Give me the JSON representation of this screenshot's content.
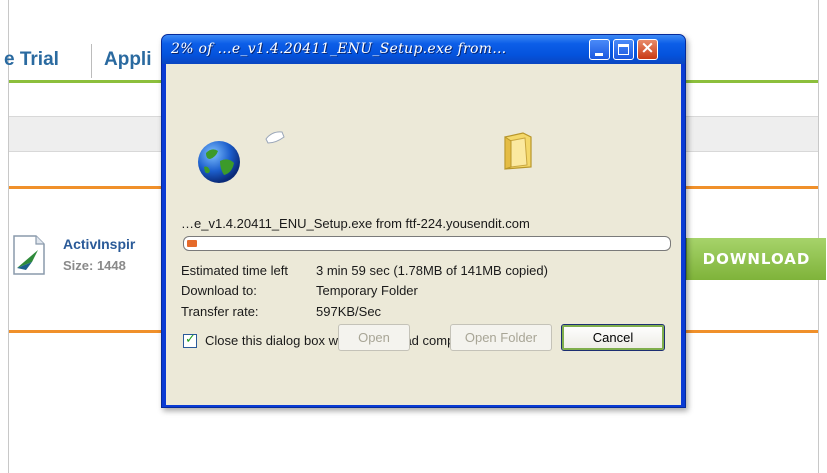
{
  "page": {
    "tabs": [
      {
        "label": "e Trial"
      },
      {
        "label": "Appli"
      }
    ],
    "file": {
      "name": "ActivInspir",
      "size": "Size: 1448"
    },
    "download_button": "DOWNLOAD"
  },
  "dialog": {
    "title": "2% of …e_v1.4.20411_ENU_Setup.exe from…",
    "filename_line": "…e_v1.4.20411_ENU_Setup.exe from ftf-224.yousendit.com",
    "progress_percent": 2,
    "progress_color": "#e56a2a",
    "estimated_label": "Estimated time left",
    "estimated_value": "3 min 59 sec (1.78MB of 141MB copied)",
    "download_to_label": "Download to:",
    "download_to_value": "Temporary Folder",
    "transfer_rate_label": "Transfer rate:",
    "transfer_rate_value": "597KB/Sec",
    "close_checkbox_label": "Close this dialog box when download completes",
    "close_checkbox_checked": true,
    "buttons": {
      "open": "Open",
      "open_folder": "Open Folder",
      "cancel": "Cancel"
    },
    "title_buttons": {
      "minimize": "minimize-icon",
      "maximize": "maximize-icon",
      "close": "close-icon"
    }
  },
  "colors": {
    "title_bar": "#0c5ee8",
    "tab_text": "#2a6aa0",
    "green_accent": "#8cbf3c",
    "orange_accent": "#f0902a",
    "download_button": "#8cc04a"
  }
}
